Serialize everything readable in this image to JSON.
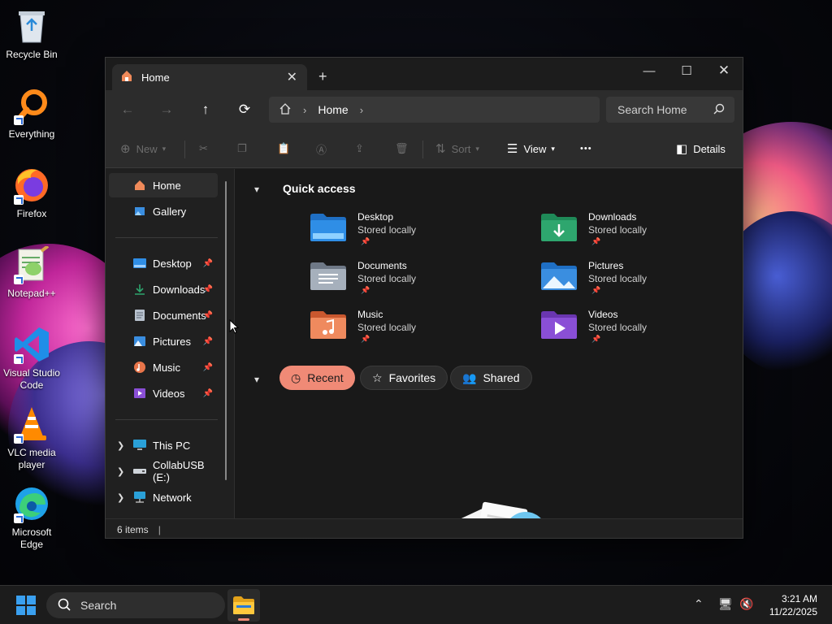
{
  "desktop": {
    "icons": [
      {
        "label": "Recycle Bin",
        "icon": "recycle-bin-icon"
      },
      {
        "label": "Everything",
        "icon": "everything-search-icon"
      },
      {
        "label": "Firefox",
        "icon": "firefox-icon"
      },
      {
        "label": "Notepad++",
        "icon": "notepad-plus-plus-icon"
      },
      {
        "label": "Visual Studio Code",
        "icon": "vscode-icon"
      },
      {
        "label": "VLC media player",
        "icon": "vlc-icon"
      },
      {
        "label": "Microsoft Edge",
        "icon": "edge-icon"
      }
    ]
  },
  "window": {
    "tab_title": "Home",
    "tab_close": "✕",
    "new_tab": "+",
    "controls": {
      "minimize": "—",
      "maximize": "☐",
      "close": "✕"
    },
    "nav": {
      "back": "←",
      "forward": "→",
      "up": "↑",
      "refresh": "⟳"
    },
    "address": {
      "crumb": "Home",
      "sep": "›"
    },
    "search": {
      "placeholder": "Search Home"
    },
    "command_bar": {
      "new_label": "New",
      "sort_label": "Sort",
      "view_label": "View",
      "more_label": "•••",
      "details_label": "Details"
    },
    "sidebar": {
      "top": [
        {
          "label": "Home",
          "icon": "home-icon"
        },
        {
          "label": "Gallery",
          "icon": "gallery-icon"
        }
      ],
      "pinned": [
        {
          "label": "Desktop",
          "icon": "desktop-folder-icon"
        },
        {
          "label": "Downloads",
          "icon": "downloads-icon"
        },
        {
          "label": "Documents",
          "icon": "documents-icon"
        },
        {
          "label": "Pictures",
          "icon": "pictures-icon"
        },
        {
          "label": "Music",
          "icon": "music-icon"
        },
        {
          "label": "Videos",
          "icon": "videos-icon"
        }
      ],
      "drives": [
        {
          "label": "This PC",
          "icon": "computer-icon"
        },
        {
          "label": "CollabUSB (E:)",
          "icon": "usb-drive-icon"
        },
        {
          "label": "Network",
          "icon": "network-icon"
        }
      ]
    },
    "quick_access": {
      "title": "Quick access",
      "items": [
        {
          "name": "Desktop",
          "status": "Stored locally",
          "color": "#2f8ee6"
        },
        {
          "name": "Downloads",
          "status": "Stored locally",
          "color": "#2ea66e"
        },
        {
          "name": "Documents",
          "status": "Stored locally",
          "color": "#8a96a6"
        },
        {
          "name": "Pictures",
          "status": "Stored locally",
          "color": "#3a8ee0"
        },
        {
          "name": "Music",
          "status": "Stored locally",
          "color": "#e8754a"
        },
        {
          "name": "Videos",
          "status": "Stored locally",
          "color": "#8a4fd6"
        }
      ]
    },
    "filters": {
      "recent": "Recent",
      "favorites": "Favorites",
      "shared": "Shared"
    },
    "status": "6 items"
  },
  "taskbar": {
    "search_placeholder": "Search",
    "time": "3:21 AM",
    "date": "11/22/2025"
  },
  "colors": {
    "accent": "#f08a76",
    "window_bg": "#202020",
    "content_bg": "#191919"
  }
}
